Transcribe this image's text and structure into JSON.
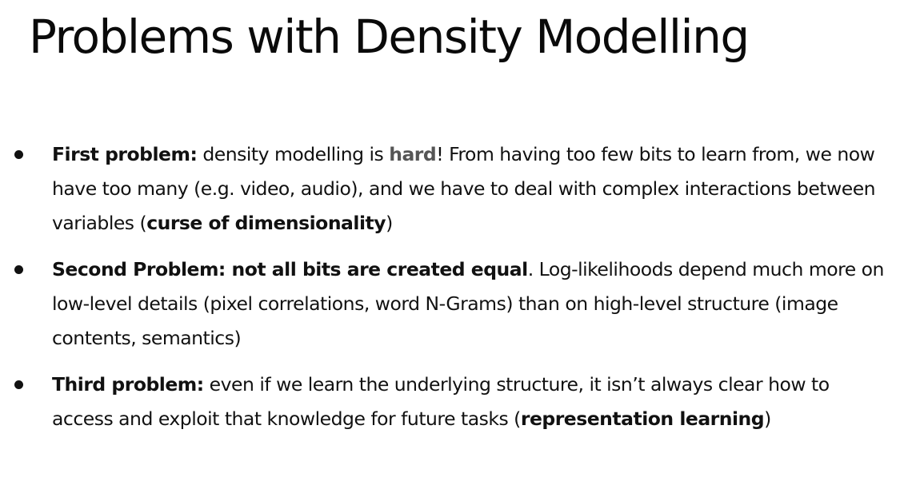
{
  "slide": {
    "title": "Problems with Density Modelling",
    "bullets": [
      {
        "lead": "First problem:",
        "t1": " density modelling is ",
        "hard": "hard",
        "t2": "! From having too few bits to learn from, we now have too many (e.g. video, audio), and we have to deal with complex interactions between variables (",
        "em": "curse of dimensionality",
        "t3": ")"
      },
      {
        "lead": "Second Problem: not all bits are created equal",
        "t1": ". Log-likelihoods depend much more on low-level details (pixel correlations, word N-Grams) than on high-level structure (image contents, semantics)"
      },
      {
        "lead": "Third problem:",
        "t1": " even if we learn the underlying structure, it isn’t always clear how to access and exploit that knowledge for future tasks (",
        "em": "representation learning",
        "t2": ")"
      }
    ]
  }
}
